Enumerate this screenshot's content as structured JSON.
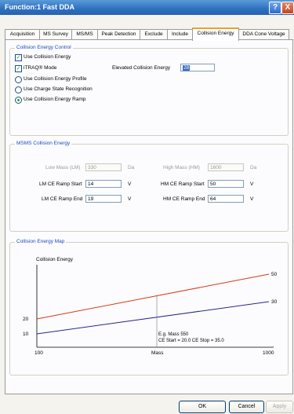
{
  "window": {
    "title": "Function:1 Fast DDA",
    "help_label": "?",
    "close_label": "X"
  },
  "tabs": [
    {
      "label": "Acquisition"
    },
    {
      "label": "MS Survey"
    },
    {
      "label": "MS/MS"
    },
    {
      "label": "Peak Detection"
    },
    {
      "label": "Exclude"
    },
    {
      "label": "Include"
    },
    {
      "label": "Collision Energy"
    },
    {
      "label": "DDA Cone Voltage"
    }
  ],
  "ce_control": {
    "title": "Collision Energy Control",
    "use_collision_energy": "Use Collision Energy",
    "itraq_mode": "iTRAQ® Mode",
    "elevated_label": "Elevated Collision Energy",
    "elevated_value": "28",
    "use_profile": "Use Collision Energy Profile",
    "use_charge": "Use Charge State Recognition",
    "use_ramp": "Use Collision Energy Ramp",
    "check_mark": "✓"
  },
  "msms": {
    "title": "MSMS Collision Energy",
    "low_mass_label": "Low Mass (LM)",
    "low_mass_value": "330",
    "high_mass_label": "High Mass (HM)",
    "high_mass_value": "1600",
    "da_unit": "Da",
    "lm_start_label": "LM CE Ramp Start",
    "lm_start_value": "14",
    "lm_end_label": "LM CE Ramp End",
    "lm_end_value": "19",
    "hm_start_label": "HM CE Ramp Start",
    "hm_start_value": "50",
    "hm_end_label": "HM CE Ramp End",
    "hm_end_value": "64",
    "v_unit": "V"
  },
  "map": {
    "title": "Collision Energy Map",
    "y_label": "Collision Energy",
    "x_label": "Mass",
    "x_min": "100",
    "x_max": "1000",
    "y_left_high": "20",
    "y_left_low": "10",
    "y_right_high": "50",
    "y_right_low": "30",
    "note_line1": "E.g. Mass 550",
    "note_line2": "CE Start = 20.0  CE Stop = 35.0",
    "colors": {
      "red_line": "#d63a1a",
      "blue_line": "#27278f"
    }
  },
  "buttons": {
    "ok": "OK",
    "cancel": "Cancel",
    "apply": "Apply"
  }
}
